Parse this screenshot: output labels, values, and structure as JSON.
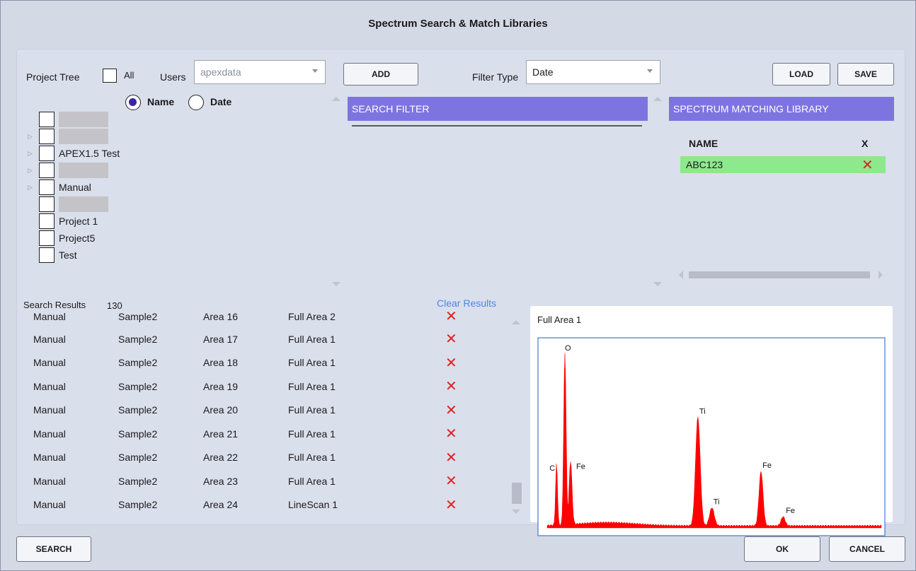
{
  "window": {
    "title": "Spectrum Search & Match Libraries"
  },
  "project": {
    "label": "Project Tree",
    "all_label": "All",
    "users_label": "Users",
    "users_value": "apexdata",
    "sort_name": "Name",
    "sort_date": "Date",
    "tree": [
      {
        "label": "",
        "redacted": true,
        "expandable": false
      },
      {
        "label": "",
        "redacted": true,
        "expandable": true
      },
      {
        "label": "APEX1.5 Test",
        "redacted": false,
        "expandable": true
      },
      {
        "label": "",
        "redacted": true,
        "expandable": true
      },
      {
        "label": "Manual",
        "redacted": false,
        "expandable": true
      },
      {
        "label": "",
        "redacted": true,
        "expandable": false
      },
      {
        "label": "Project 1",
        "redacted": false,
        "expandable": false
      },
      {
        "label": "Project5",
        "redacted": false,
        "expandable": false
      },
      {
        "label": "Test",
        "redacted": false,
        "expandable": false
      }
    ]
  },
  "toolbar": {
    "add": "ADD",
    "filter_type_label": "Filter Type",
    "filter_type_value": "Date",
    "load": "LOAD",
    "save": "SAVE"
  },
  "search_filter": {
    "header": "SEARCH FILTER"
  },
  "library": {
    "header": "SPECTRUM MATCHING LIBRARY",
    "col_name": "NAME",
    "col_x": "X",
    "rows": [
      {
        "name": "ABC123",
        "remove": "✕"
      }
    ]
  },
  "results": {
    "label": "Search Results",
    "count": "130",
    "clear": "Clear Results",
    "partial_row": {
      "project": "Manual",
      "sample": "Sample2",
      "area": "Area 16",
      "field": "Full Area 2"
    },
    "rows": [
      {
        "project": "Manual",
        "sample": "Sample2",
        "area": "Area 17",
        "field": "Full Area 1",
        "remove": "✕"
      },
      {
        "project": "Manual",
        "sample": "Sample2",
        "area": "Area 18",
        "field": "Full Area 1",
        "remove": "✕"
      },
      {
        "project": "Manual",
        "sample": "Sample2",
        "area": "Area 19",
        "field": "Full Area 1",
        "remove": "✕"
      },
      {
        "project": "Manual",
        "sample": "Sample2",
        "area": "Area 20",
        "field": "Full Area 1",
        "remove": "✕"
      },
      {
        "project": "Manual",
        "sample": "Sample2",
        "area": "Area 21",
        "field": "Full Area 1",
        "remove": "✕"
      },
      {
        "project": "Manual",
        "sample": "Sample2",
        "area": "Area 22",
        "field": "Full Area 1",
        "remove": "✕"
      },
      {
        "project": "Manual",
        "sample": "Sample2",
        "area": "Area 23",
        "field": "Full Area 1",
        "remove": "✕"
      },
      {
        "project": "Manual",
        "sample": "Sample2",
        "area": "Area 24",
        "field": "LineScan 1",
        "remove": "✕"
      }
    ]
  },
  "chart": {
    "title": "Full Area 1",
    "color": "#ff0000",
    "peaks": [
      {
        "label": "O",
        "energy": 0.53,
        "height": 0.95
      },
      {
        "label": "C",
        "energy": 0.28,
        "height": 0.34
      },
      {
        "label": "Fe",
        "energy": 0.7,
        "height": 0.35
      },
      {
        "label": "Ti",
        "energy": 4.51,
        "height": 0.6
      },
      {
        "label": "Ti",
        "energy": 4.93,
        "height": 0.1
      },
      {
        "label": "Fe",
        "energy": 6.4,
        "height": 0.3
      },
      {
        "label": "Fe",
        "energy": 7.06,
        "height": 0.05
      }
    ]
  },
  "footer": {
    "search": "SEARCH",
    "ok": "OK",
    "cancel": "CANCEL"
  }
}
